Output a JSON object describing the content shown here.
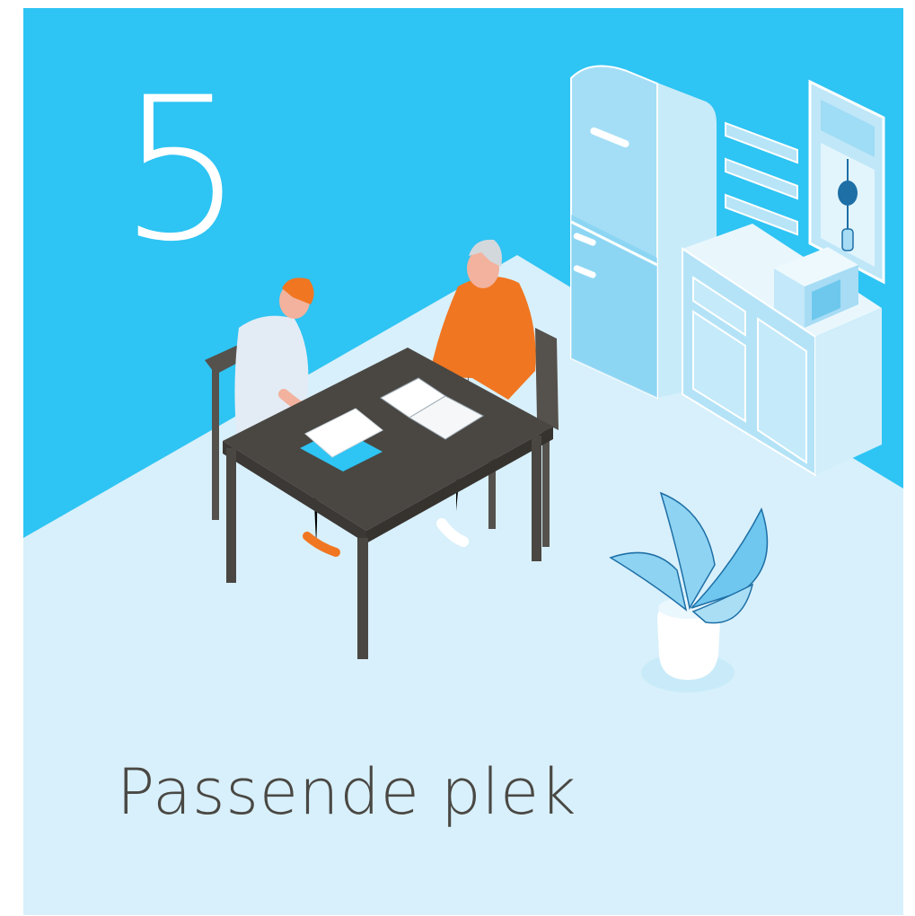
{
  "card": {
    "step_number": "5",
    "title": "Passende plek"
  },
  "colors": {
    "wall": "#2ec4f3",
    "floor": "#d8f0fb",
    "table": "#4a4743",
    "shirt": "#f07621",
    "text": "#4a4844"
  },
  "illustration": {
    "icons": [
      "person-writing-icon",
      "person-reading-icon",
      "table-icon",
      "refrigerator-icon",
      "kitchen-cabinet-icon",
      "microwave-icon",
      "window-icon",
      "shelves-icon",
      "potted-plant-icon"
    ]
  }
}
